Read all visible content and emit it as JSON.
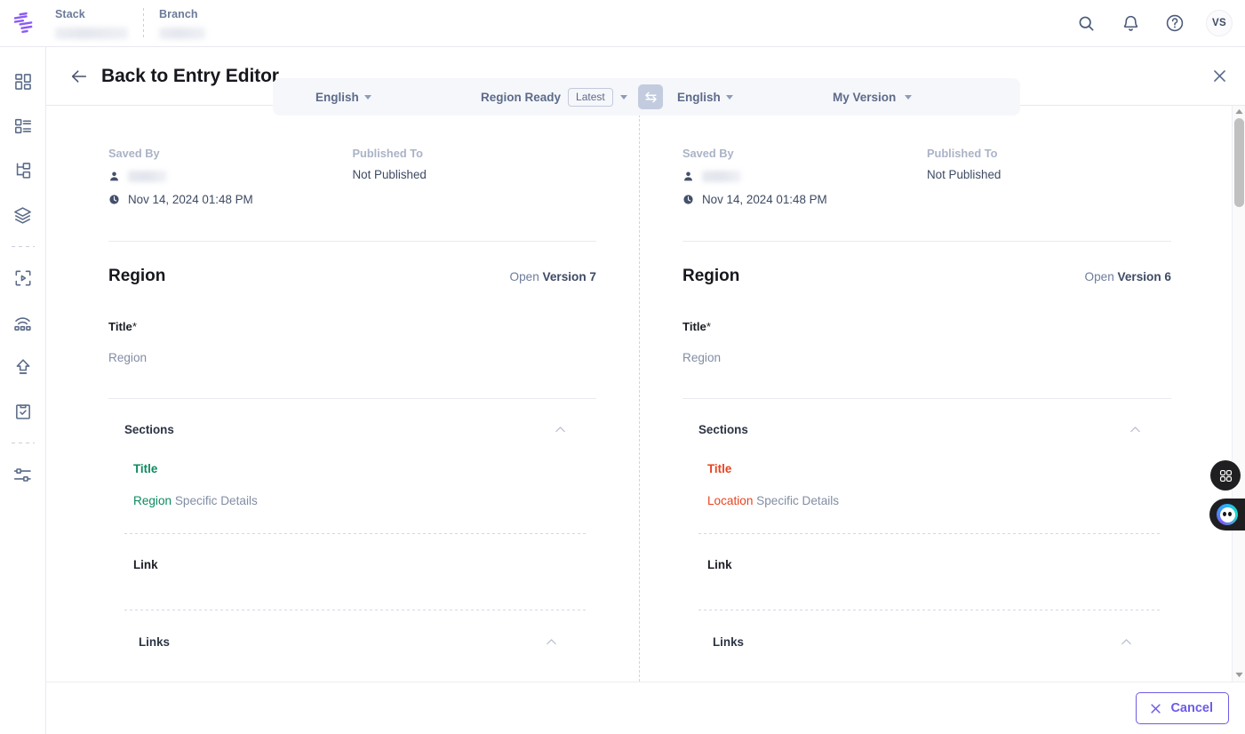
{
  "header": {
    "logo_icon": "contentstack-logo-icon",
    "breadcrumbs": [
      {
        "label": "Stack",
        "value_redacted": true
      },
      {
        "label": "Branch",
        "value_redacted": true
      }
    ],
    "actions": [
      {
        "name": "search-icon",
        "label": "Search"
      },
      {
        "name": "bell-icon",
        "label": "Notifications"
      },
      {
        "name": "help-icon",
        "label": "Help"
      }
    ],
    "avatar_initials": "vs"
  },
  "sidebar": {
    "items": [
      {
        "icon": "dashboard-icon",
        "label": "Dashboard"
      },
      {
        "icon": "content-types-icon",
        "label": "Content Models"
      },
      {
        "icon": "entries-tree-icon",
        "label": "Entries"
      },
      {
        "icon": "stack-layers-icon",
        "label": "Assets"
      },
      {
        "icon": "media-play-icon",
        "label": "Live Preview"
      },
      {
        "icon": "webhooks-icon",
        "label": "Webhooks"
      },
      {
        "icon": "publish-upload-icon",
        "label": "Publish Queue"
      },
      {
        "icon": "clipboard-check-icon",
        "label": "Workflows"
      },
      {
        "icon": "settings-sliders-icon",
        "label": "Settings"
      }
    ]
  },
  "sub_header": {
    "back_icon": "arrow-left-icon",
    "back_label": "Back to Entry Editor",
    "close_icon": "close-icon"
  },
  "toolbar": {
    "left_language": "English",
    "status_label": "Region Ready",
    "status_pill": "Latest",
    "swap_icon": "swap-arrows-icon",
    "right_language": "English",
    "version_selector": "My Version"
  },
  "panes": [
    {
      "side": "left",
      "saved_by_label": "Saved By",
      "saved_by_value_redacted": true,
      "saved_at": "Nov 14, 2024 01:48 PM",
      "published_to_label": "Published To",
      "published_to_value": "Not Published",
      "entry_title": "Region",
      "open_version_prefix": "Open",
      "open_version_value": "Version 7",
      "title_field_label": "Title",
      "title_field_required": "*",
      "title_field_value": "Region",
      "sections_group": "Sections",
      "section_sub_label": "Title",
      "section_sub_label_diff": "add",
      "section_value_changed": "Region",
      "section_value_rest": " Specific Details",
      "link_label": "Link",
      "links_group": "Links"
    },
    {
      "side": "right",
      "saved_by_label": "Saved By",
      "saved_by_value_redacted": true,
      "saved_at": "Nov 14, 2024 01:48 PM",
      "published_to_label": "Published To",
      "published_to_value": "Not Published",
      "entry_title": "Region",
      "open_version_prefix": "Open",
      "open_version_value": "Version 6",
      "title_field_label": "Title",
      "title_field_required": "*",
      "title_field_value": "Region",
      "sections_group": "Sections",
      "section_sub_label": "Title",
      "section_sub_label_diff": "delete",
      "section_value_changed": "Location",
      "section_value_rest": " Specific Details",
      "link_label": "Link",
      "links_group": "Links"
    }
  ],
  "footer": {
    "cancel_icon": "close-x-icon",
    "cancel_label": "Cancel"
  },
  "floating": {
    "apps_icon": "apps-grid-icon",
    "assistant_icon": "assistant-avatar-icon"
  },
  "scrollbar": {
    "up_icon": "caret-up-icon",
    "down_icon": "caret-down-icon"
  },
  "colors": {
    "brand_purple": "#6c5ce7",
    "diff_added": "#0d8a5f",
    "diff_removed": "#e8431f",
    "text_primary": "#16181d",
    "text_muted": "#828da3",
    "toolbar_bg": "#f6f7fb"
  }
}
